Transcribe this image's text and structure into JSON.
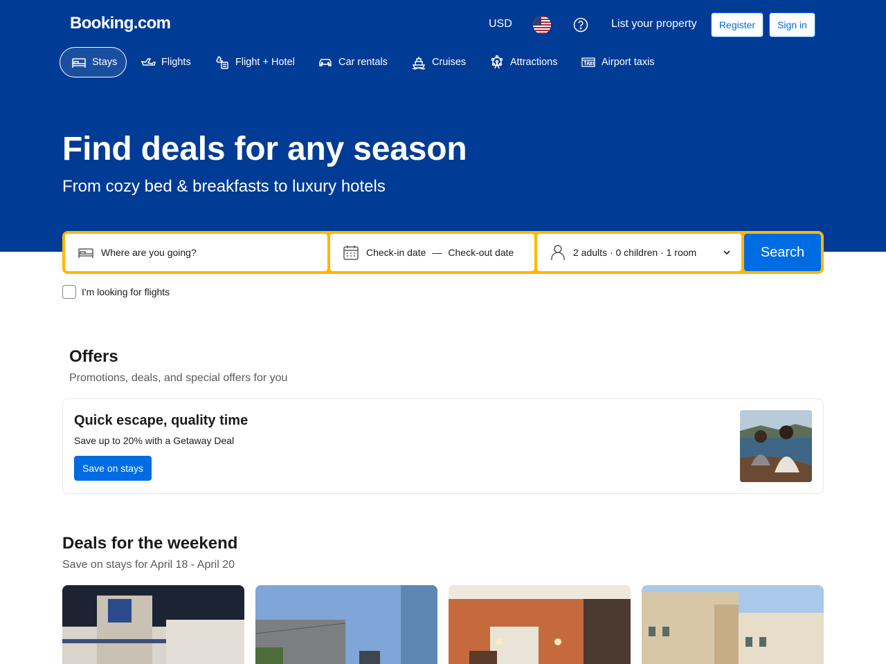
{
  "header": {
    "logo": "Booking.com",
    "currency": "USD",
    "flag_icon": "us-flag-icon",
    "help_icon": "help-circle-icon",
    "list_property": "List your property",
    "register": "Register",
    "sign_in": "Sign in"
  },
  "nav": {
    "tabs": [
      {
        "label": "Stays",
        "icon": "bed-icon",
        "active": true
      },
      {
        "label": "Flights",
        "icon": "plane-icon"
      },
      {
        "label": "Flight + Hotel",
        "icon": "flight-hotel-icon"
      },
      {
        "label": "Car rentals",
        "icon": "car-icon"
      },
      {
        "label": "Cruises",
        "icon": "ship-icon"
      },
      {
        "label": "Attractions",
        "icon": "ferris-wheel-icon"
      },
      {
        "label": "Airport taxis",
        "icon": "taxi-icon"
      }
    ]
  },
  "hero": {
    "title": "Find deals for any season",
    "subtitle": "From cozy bed & breakfasts to luxury hotels"
  },
  "search": {
    "destination_placeholder": "Where are you going?",
    "checkin": "Check-in date",
    "date_separator": "—",
    "checkout": "Check-out date",
    "guests": "2 adults · 0 children · 1 room",
    "button": "Search",
    "flights_checkbox": "I'm looking for flights"
  },
  "offers": {
    "title": "Offers",
    "subtitle": "Promotions, deals, and special offers for you",
    "card": {
      "title": "Quick escape, quality time",
      "description": "Save up to 20% with a Getaway Deal",
      "button": "Save on stays"
    }
  },
  "deals": {
    "title": "Deals for the weekend",
    "subtitle": "Save on stays for April 18 - April 20"
  },
  "colors": {
    "brand_blue": "#003b95",
    "action_blue": "#006ce4",
    "search_border": "#ffb700"
  }
}
